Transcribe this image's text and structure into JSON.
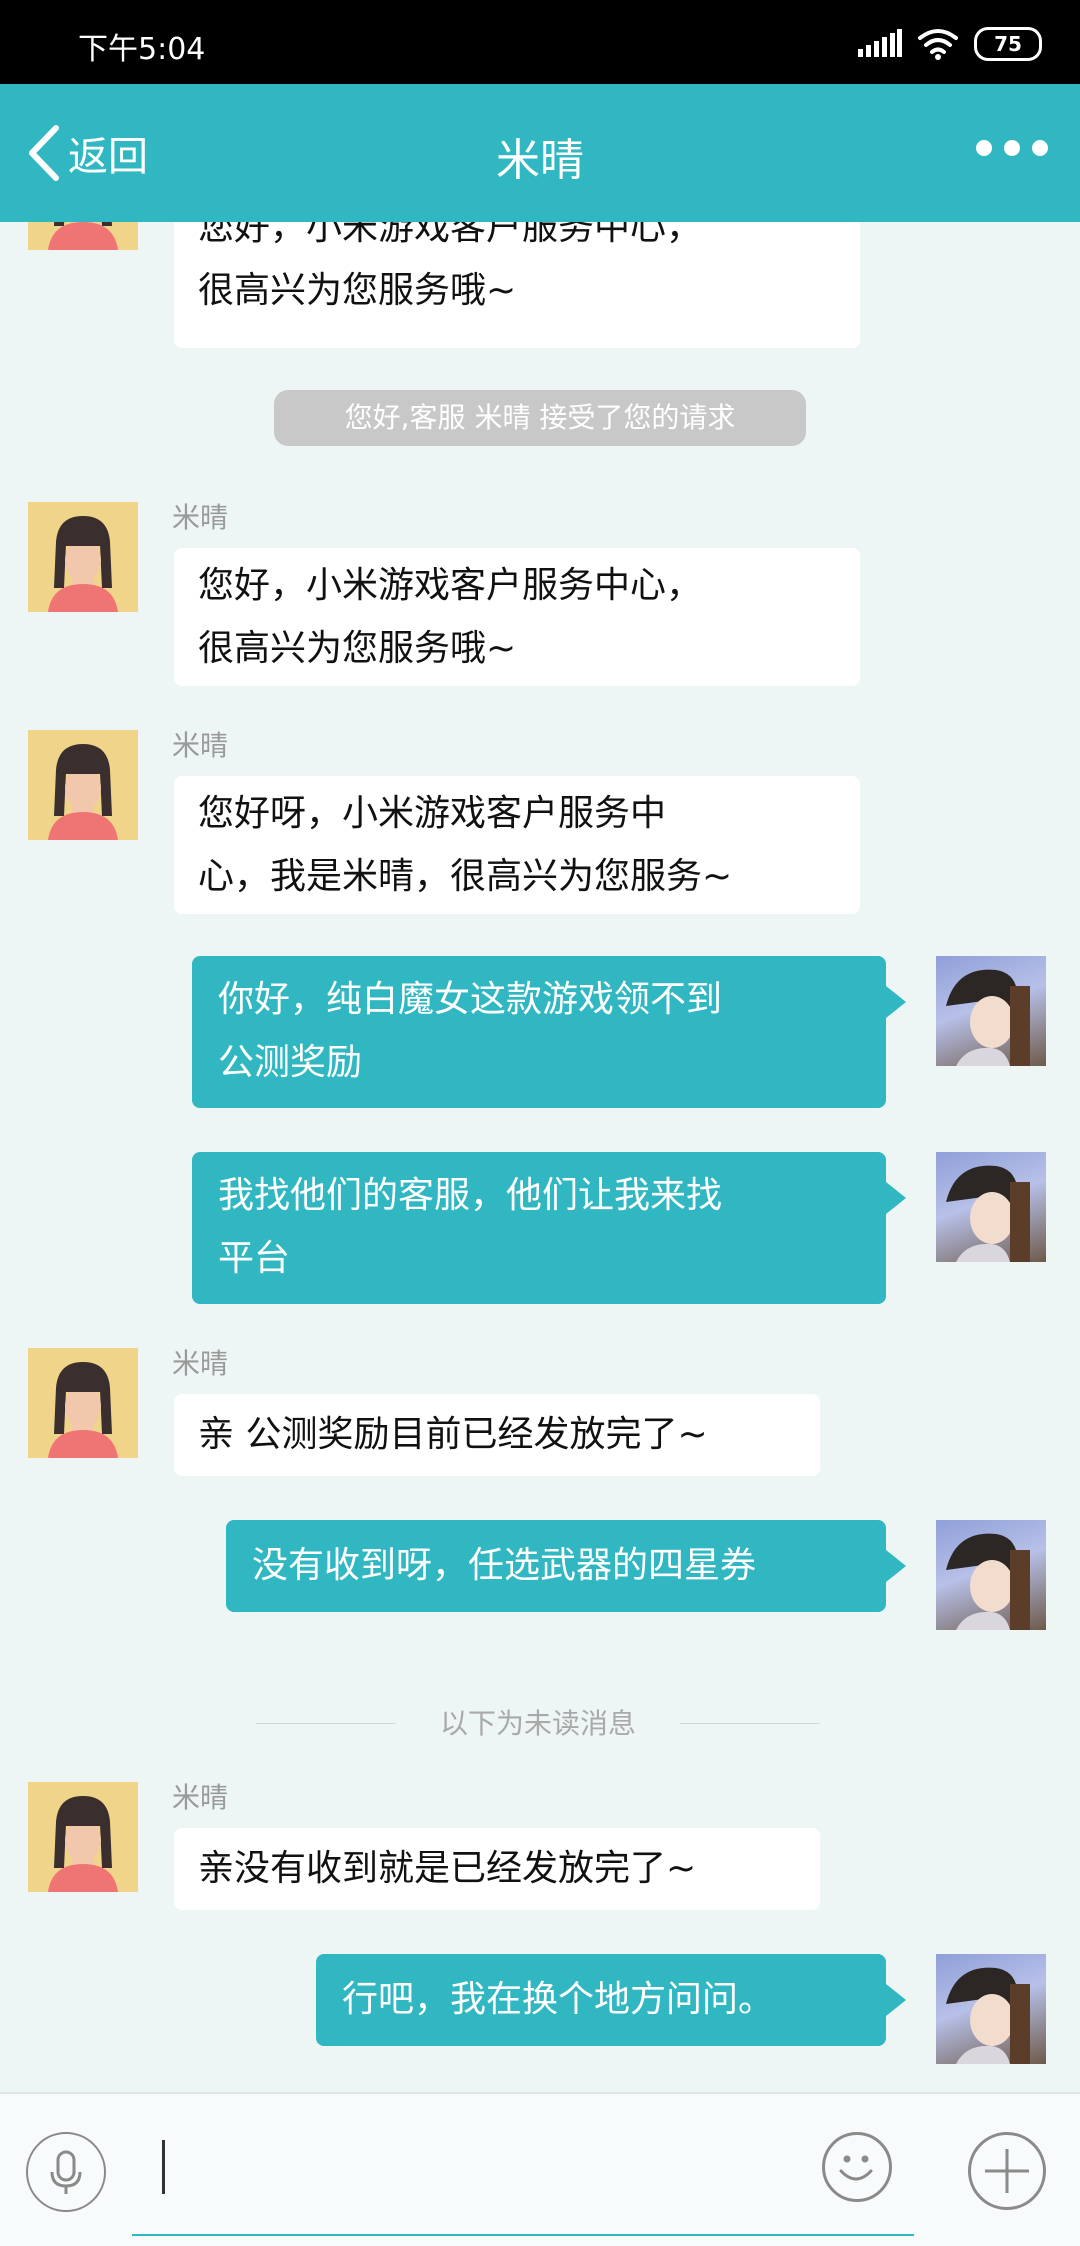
{
  "status_bar": {
    "time": "下午5:04",
    "battery": "75"
  },
  "header": {
    "back_label": "返回",
    "title": "米晴"
  },
  "chat": {
    "messages": [
      {
        "text_line1": "您好，小米游戏客户服务中心，",
        "text_line2": "很高兴为您服务哦~"
      },
      {
        "sender": "米晴",
        "text_line1": "您好，小米游戏客户服务中心，",
        "text_line2": "很高兴为您服务哦~"
      },
      {
        "sender": "米晴",
        "text_line1": "您好呀，小米游戏客户服务中",
        "text_line2": "心，我是米晴，很高兴为您服务~"
      },
      {
        "text_line1": "你好，纯白魔女这款游戏领不到",
        "text_line2": "公测奖励"
      },
      {
        "text_line1": "我找他们的客服，他们让我来找",
        "text_line2": "平台"
      },
      {
        "sender": "米晴",
        "text": "亲 公测奖励目前已经发放完了~"
      },
      {
        "text": "没有收到呀，任选武器的四星券"
      },
      {
        "sender": "米晴",
        "text": "亲没有收到就是已经发放完了~"
      },
      {
        "text": "行吧，我在换个地方问问。"
      }
    ],
    "system_notice": "您好,客服 米晴 接受了您的请求",
    "unread_divider": "以下为未读消息"
  },
  "input_bar": {
    "value": "",
    "placeholder": ""
  },
  "icons": {
    "status": [
      "signal-icon",
      "wifi-icon",
      "battery-icon"
    ],
    "header": [
      "back-arrow-icon",
      "more-icon"
    ],
    "input": [
      "microphone-icon",
      "emoji-icon",
      "plus-icon"
    ]
  },
  "colors": {
    "accent": "#31b7c2",
    "background": "#eef5f5",
    "incoming_bubble": "#ffffff",
    "system_notice": "#c8c8c8"
  }
}
